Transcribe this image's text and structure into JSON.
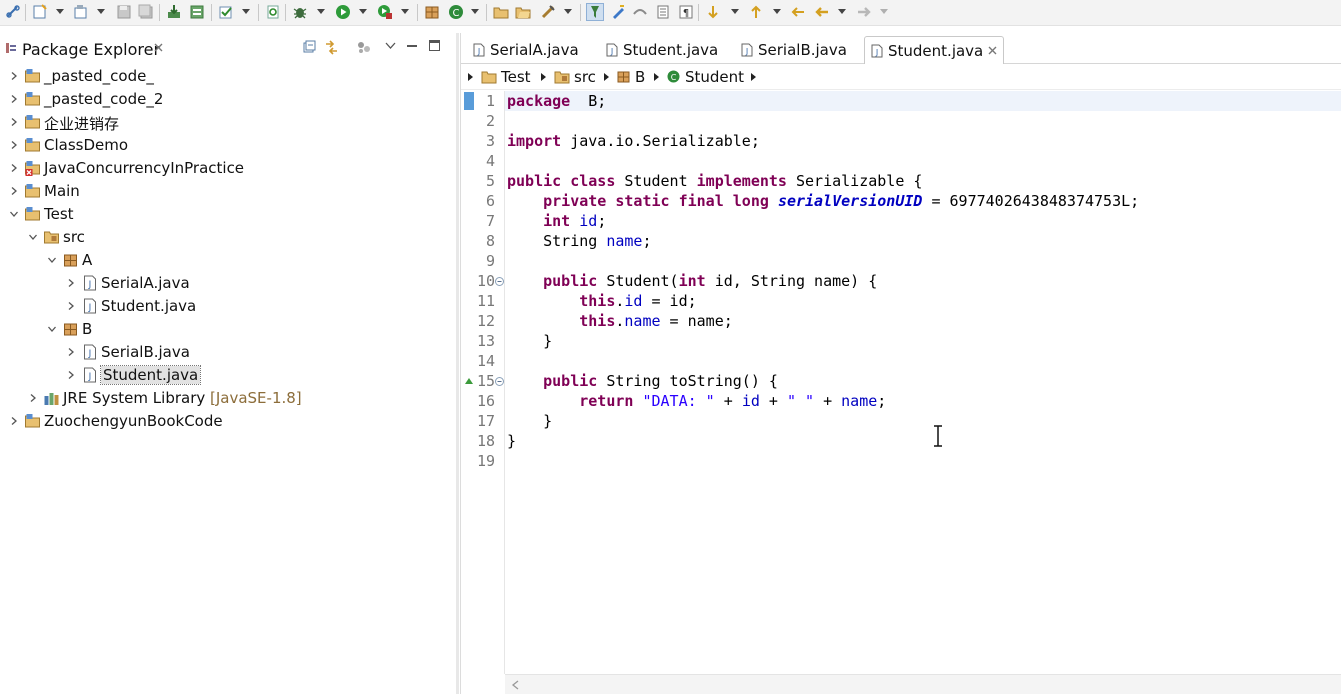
{
  "toolbar": {
    "icons": [
      "link-icon",
      "new-icon",
      "new-type-icon",
      "save-icon",
      "save-all-icon",
      "import-icon",
      "build-icon",
      "task-icon",
      "refresh-icon",
      "debug-icon",
      "run-icon",
      "external-tool-icon",
      "new-package-icon",
      "new-class-icon",
      "open-folder-icon",
      "open-folder-icon",
      "search-icon",
      "highlight-occurrences-icon",
      "pen-icon",
      "toggle-mark-icon",
      "block-selection-icon",
      "whitespace-icon",
      "next-annotation-icon",
      "prev-annotation-icon",
      "last-edit-icon",
      "back-icon",
      "forward-icon"
    ]
  },
  "package_explorer": {
    "title": "Package Explorer",
    "tree": [
      {
        "label": "_pasted_code_",
        "icon": "project-icon",
        "depth": 0,
        "twisty": "collapsed"
      },
      {
        "label": "_pasted_code_2",
        "icon": "project-icon",
        "depth": 0,
        "twisty": "collapsed"
      },
      {
        "label": "企业进销存",
        "icon": "project-icon",
        "depth": 0,
        "twisty": "collapsed"
      },
      {
        "label": "ClassDemo",
        "icon": "project-icon",
        "depth": 0,
        "twisty": "collapsed"
      },
      {
        "label": "JavaConcurrencyInPractice",
        "icon": "project-error-icon",
        "depth": 0,
        "twisty": "collapsed"
      },
      {
        "label": "Main",
        "icon": "project-icon",
        "depth": 0,
        "twisty": "collapsed"
      },
      {
        "label": "Test",
        "icon": "project-icon",
        "depth": 0,
        "twisty": "expanded"
      },
      {
        "label": "src",
        "icon": "source-folder-icon",
        "depth": 1,
        "twisty": "expanded"
      },
      {
        "label": "A",
        "icon": "package-icon",
        "depth": 2,
        "twisty": "expanded"
      },
      {
        "label": "SerialA.java",
        "icon": "java-file-icon",
        "depth": 3,
        "twisty": "collapsed"
      },
      {
        "label": "Student.java",
        "icon": "java-file-icon",
        "depth": 3,
        "twisty": "collapsed"
      },
      {
        "label": "B",
        "icon": "package-icon",
        "depth": 2,
        "twisty": "expanded"
      },
      {
        "label": "SerialB.java",
        "icon": "java-file-icon",
        "depth": 3,
        "twisty": "collapsed"
      },
      {
        "label": "Student.java",
        "icon": "java-file-icon",
        "depth": 3,
        "twisty": "collapsed",
        "selected": true
      },
      {
        "label": "JRE System Library",
        "tag": "[JavaSE-1.8]",
        "icon": "library-icon",
        "depth": 1,
        "twisty": "collapsed"
      },
      {
        "label": "ZuochengyunBookCode",
        "icon": "project-icon",
        "depth": 0,
        "twisty": "collapsed"
      }
    ]
  },
  "editor": {
    "tabs": [
      {
        "label": "SerialA.java",
        "active": false
      },
      {
        "label": "Student.java",
        "active": false
      },
      {
        "label": "SerialB.java",
        "active": false
      },
      {
        "label": "Student.java",
        "active": true
      }
    ],
    "breadcrumb": [
      "Test",
      "src",
      "B",
      "Student"
    ],
    "code_lines": [
      [
        [
          "kw",
          "package"
        ],
        [
          "",
          "  B;"
        ]
      ],
      [],
      [
        [
          "kw",
          "import"
        ],
        [
          "",
          " java.io.Serializable;"
        ]
      ],
      [],
      [
        [
          "kw",
          "public"
        ],
        [
          "",
          " "
        ],
        [
          "kw",
          "class"
        ],
        [
          "",
          " Student "
        ],
        [
          "kw",
          "implements"
        ],
        [
          "",
          " Serializable {"
        ]
      ],
      [
        [
          "",
          "    "
        ],
        [
          "kw",
          "private"
        ],
        [
          "",
          " "
        ],
        [
          "kw",
          "static"
        ],
        [
          "",
          " "
        ],
        [
          "kw",
          "final"
        ],
        [
          "",
          " "
        ],
        [
          "kw",
          "long"
        ],
        [
          "",
          " "
        ],
        [
          "sfld",
          "serialVersionUID"
        ],
        [
          "",
          " = 6977402643848374753L;"
        ]
      ],
      [
        [
          "",
          "    "
        ],
        [
          "kw",
          "int"
        ],
        [
          "",
          " "
        ],
        [
          "fld",
          "id"
        ],
        [
          "",
          ";"
        ]
      ],
      [
        [
          "",
          "    String "
        ],
        [
          "fld",
          "name"
        ],
        [
          "",
          ";"
        ]
      ],
      [],
      [
        [
          "",
          "    "
        ],
        [
          "kw",
          "public"
        ],
        [
          "",
          " Student("
        ],
        [
          "kw",
          "int"
        ],
        [
          "",
          " id, String name) {"
        ]
      ],
      [
        [
          "",
          "        "
        ],
        [
          "kw",
          "this"
        ],
        [
          "",
          "."
        ],
        [
          "fld",
          "id"
        ],
        [
          "",
          " = id;"
        ]
      ],
      [
        [
          "",
          "        "
        ],
        [
          "kw",
          "this"
        ],
        [
          "",
          "."
        ],
        [
          "fld",
          "name"
        ],
        [
          "",
          " = name;"
        ]
      ],
      [
        [
          "",
          "    }"
        ]
      ],
      [],
      [
        [
          "",
          "    "
        ],
        [
          "kw",
          "public"
        ],
        [
          "",
          " String toString() {"
        ]
      ],
      [
        [
          "",
          "        "
        ],
        [
          "kw",
          "return"
        ],
        [
          "",
          " "
        ],
        [
          "str",
          "\"DATA: \""
        ],
        [
          "",
          " + "
        ],
        [
          "fld",
          "id"
        ],
        [
          "",
          " + "
        ],
        [
          "str",
          "\" \""
        ],
        [
          "",
          " + "
        ],
        [
          "fld",
          "name"
        ],
        [
          "",
          ";"
        ]
      ],
      [
        [
          "",
          "    }"
        ]
      ],
      [
        [
          "",
          "}"
        ]
      ],
      []
    ],
    "fold_lines": [
      10,
      15
    ],
    "override_marker_line": 15,
    "current_line": 1
  },
  "colors": {
    "keyword": "#7f0055",
    "field": "#0000c0",
    "string": "#2a00ff",
    "line_number": "#787878",
    "current_line": "#eef3fb"
  }
}
